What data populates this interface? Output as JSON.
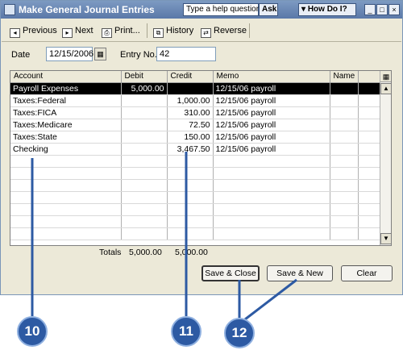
{
  "window": {
    "title": "Make General Journal Entries",
    "help_placeholder": "Type a help question",
    "ask_label": "Ask",
    "how_do_i_label": "How Do I?",
    "controls": [
      "_",
      "□",
      "×"
    ]
  },
  "toolbar": {
    "previous": "Previous",
    "next": "Next",
    "print": "Print...",
    "history": "History",
    "reverse": "Reverse"
  },
  "fields": {
    "date_label": "Date",
    "date_value": "12/15/2006",
    "entry_label": "Entry No.",
    "entry_value": "42"
  },
  "grid": {
    "columns": [
      "Account",
      "Debit",
      "Credit",
      "Memo",
      "Name"
    ],
    "rows": [
      {
        "account": "Payroll Expenses",
        "debit": "5,000.00",
        "credit": "",
        "memo": "12/15/06 payroll",
        "name": ""
      },
      {
        "account": "Taxes:Federal",
        "debit": "",
        "credit": "1,000.00",
        "memo": "12/15/06 payroll",
        "name": ""
      },
      {
        "account": "Taxes:FICA",
        "debit": "",
        "credit": "310.00",
        "memo": "12/15/06 payroll",
        "name": ""
      },
      {
        "account": "Taxes:Medicare",
        "debit": "",
        "credit": "72.50",
        "memo": "12/15/06 payroll",
        "name": ""
      },
      {
        "account": "Taxes:State",
        "debit": "",
        "credit": "150.00",
        "memo": "12/15/06 payroll",
        "name": ""
      },
      {
        "account": "Checking",
        "debit": "",
        "credit": "3,467.50",
        "memo": "12/15/06 payroll",
        "name": ""
      }
    ]
  },
  "totals": {
    "label": "Totals",
    "debit": "5,000.00",
    "credit": "5,000.00"
  },
  "buttons": {
    "save_close": "Save & Close",
    "save_new": "Save & New",
    "clear": "Clear"
  },
  "callouts": [
    "10",
    "11",
    "12"
  ],
  "colors": {
    "callout": "#2d5aa3",
    "titlebar": "#6a88b6"
  }
}
